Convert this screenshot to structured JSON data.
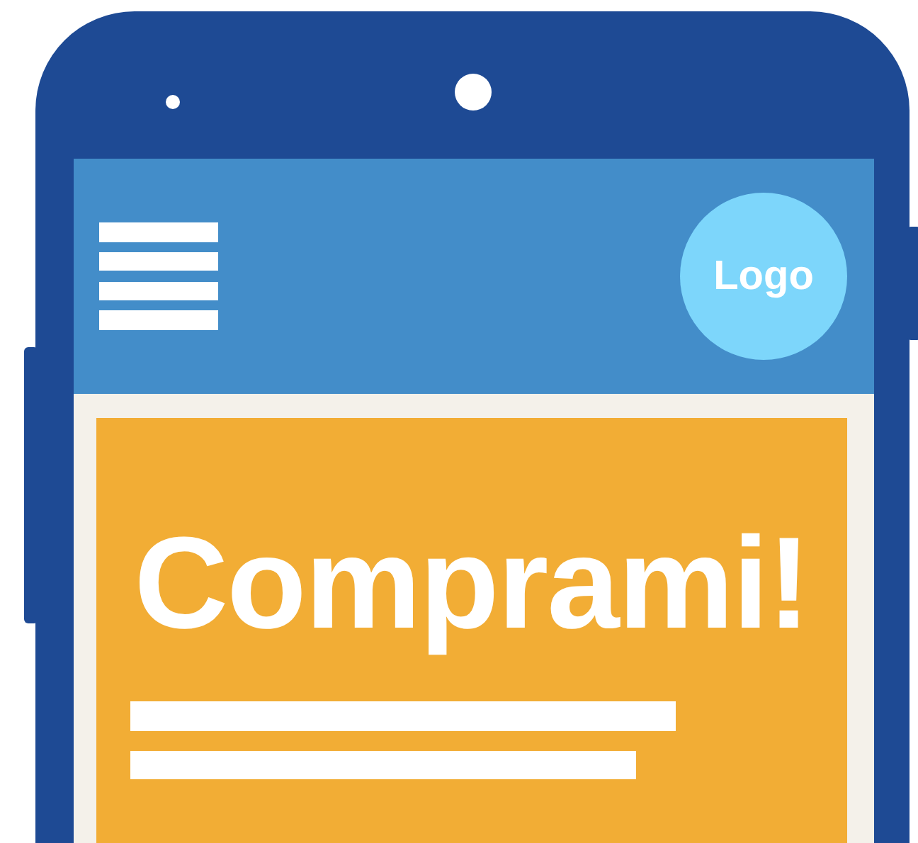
{
  "header": {
    "logo": "Logo"
  },
  "banner": {
    "headline": "Comprami!"
  }
}
